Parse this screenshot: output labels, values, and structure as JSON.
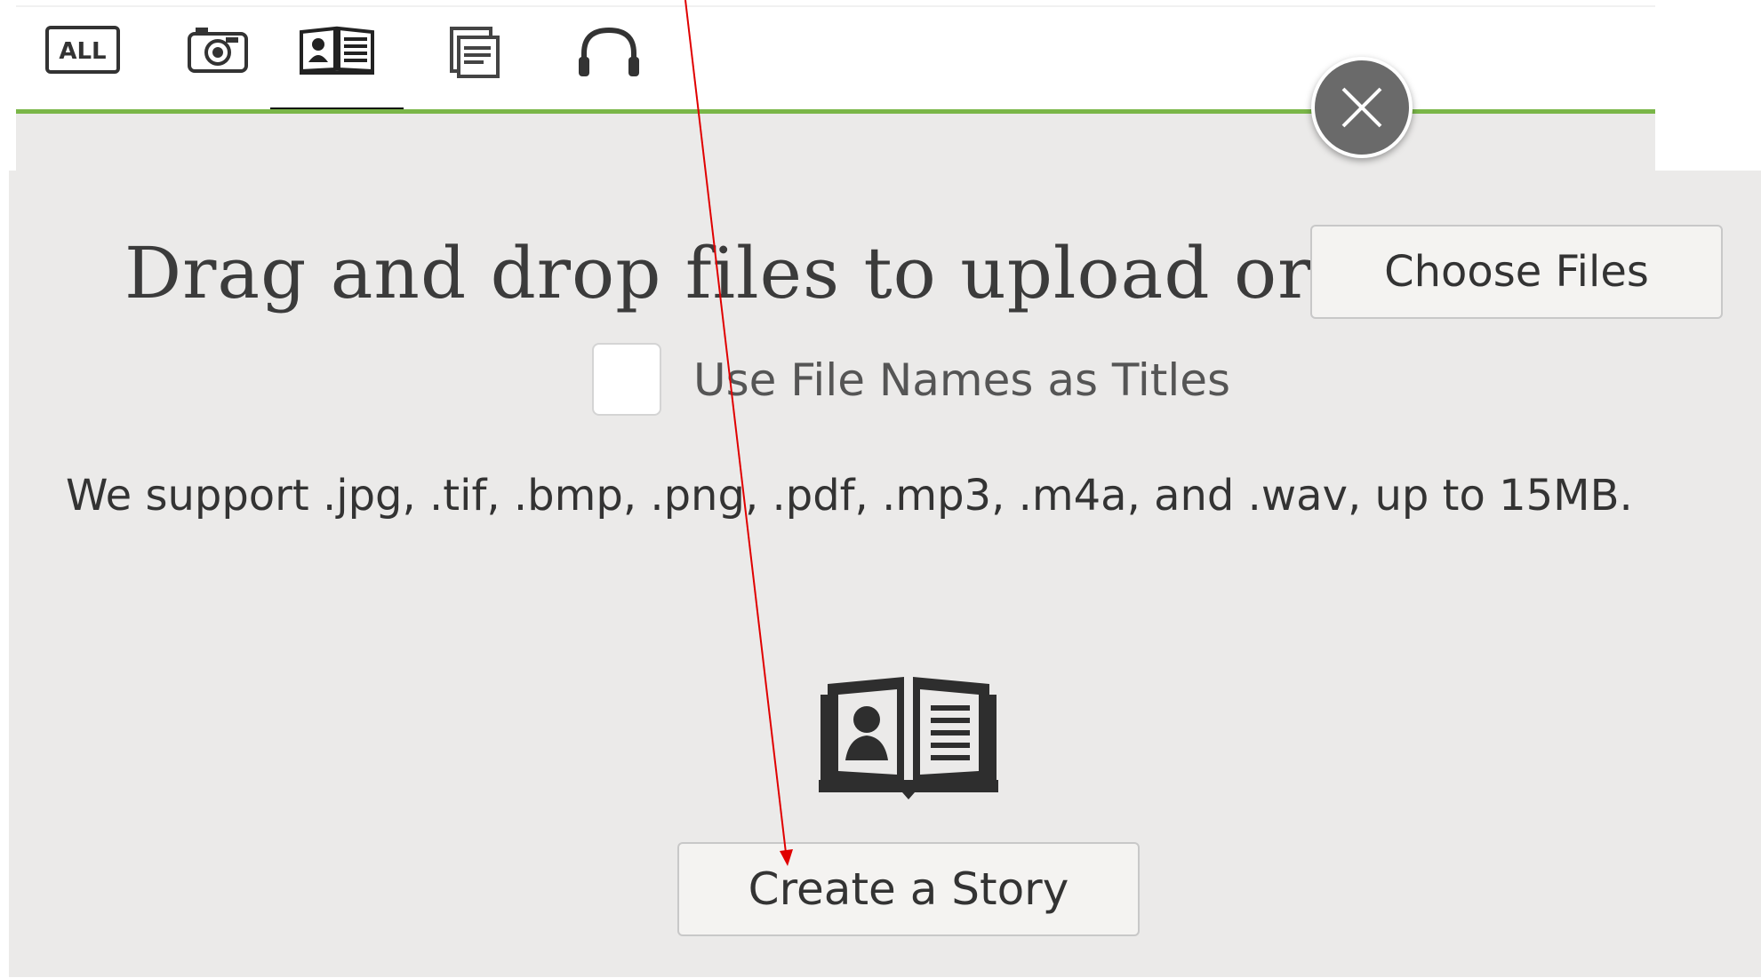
{
  "tabs": [
    {
      "name": "all",
      "label": "ALL",
      "icon": "all-icon",
      "active": false
    },
    {
      "name": "photos",
      "icon": "camera-icon",
      "active": false
    },
    {
      "name": "stories",
      "icon": "story-book-icon",
      "active": true
    },
    {
      "name": "documents",
      "icon": "document-icon",
      "active": false
    },
    {
      "name": "audio",
      "icon": "headphones-icon",
      "active": false
    }
  ],
  "upload": {
    "drag_text": "Drag and drop files to upload or",
    "choose_label": "Choose Files",
    "checkbox_label": "Use File Names as Titles",
    "support_text": "We support .jpg, .tif, .bmp, .png, .pdf, .mp3, .m4a, and .wav, up to 15MB."
  },
  "story": {
    "icon": "story-book-icon",
    "button_label": "Create a Story"
  },
  "colors": {
    "accent_green": "#7ab648",
    "panel_bg": "#ebeae9",
    "close_bg": "#6a6a6a",
    "annotation_arrow": "#e00000"
  }
}
